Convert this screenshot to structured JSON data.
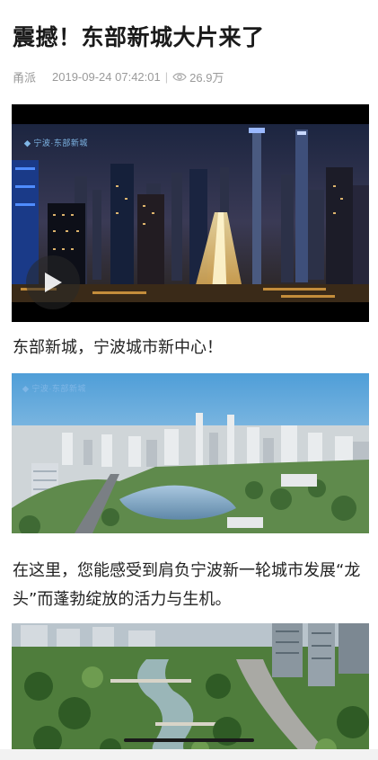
{
  "article": {
    "title": "震撼！东部新城大片来了",
    "author": "甬派",
    "datetime": "2019-09-24 07:42:01",
    "separator": "|",
    "views": "26.9万"
  },
  "video": {
    "watermark": "宁波·东部新城",
    "play_icon": "play-icon"
  },
  "paragraphs": [
    "东部新城，宁波城市新中心！",
    "在这里，您能感受到肩负宁波新一轮城市发展“龙头”而蓬勃绽放的活力与生机。"
  ],
  "images": [
    {
      "watermark": "宁波·东部新城"
    },
    {
      "watermark": ""
    }
  ],
  "colors": {
    "meta_gray": "#9a9a9a",
    "watermark_blue": "#7fb6e6"
  }
}
